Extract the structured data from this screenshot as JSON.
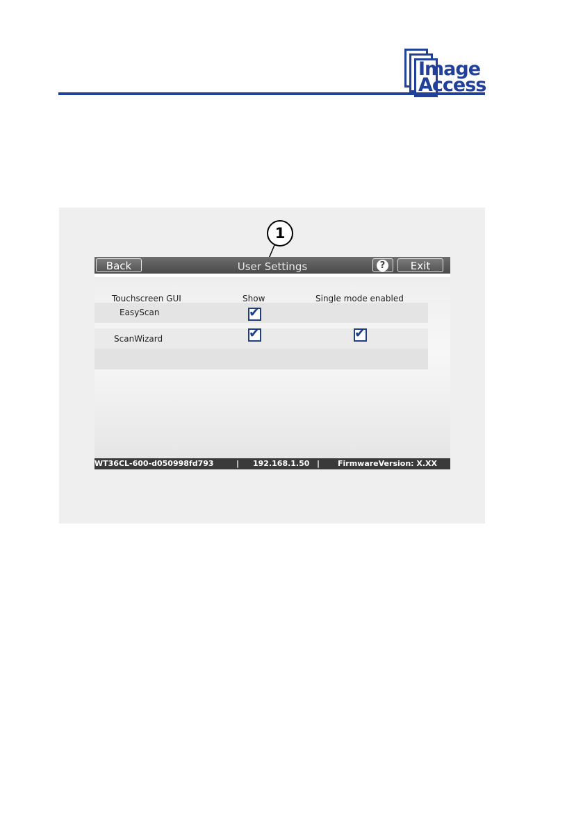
{
  "logo": {
    "line1": "Image",
    "line2": "Access"
  },
  "callout": {
    "number": "1"
  },
  "screen": {
    "title": "User Settings",
    "back_label": "Back",
    "help_label": "?",
    "exit_label": "Exit",
    "columns": [
      "Touchscreen GUI",
      "Show",
      "Single mode enabled"
    ],
    "rows": [
      {
        "label": "EasyScan",
        "show": true,
        "single_mode": false
      },
      {
        "label": "ScanWizard",
        "show": true,
        "single_mode": true
      }
    ],
    "check_glyph": "✔",
    "status": {
      "device": "WT36CL-600-d050998fd793",
      "separator": "|",
      "ip": "192.168.1.50",
      "firmware": "FirmwareVersion: X.XX"
    }
  },
  "colors": {
    "brand": "#21409a",
    "checkbox": "#1f3f85",
    "titlebar": "#555555"
  }
}
